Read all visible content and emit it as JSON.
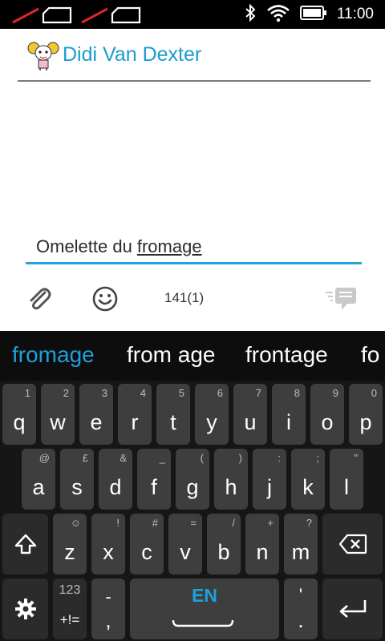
{
  "status_bar": {
    "time": "11:00",
    "icons": [
      "sim-no-signal-icon",
      "sim-no-signal-icon",
      "bluetooth-icon",
      "wifi-icon",
      "battery-icon"
    ]
  },
  "conversation": {
    "contact_name": "Didi Van Dexter",
    "message_text": "Omelette du",
    "message_word": "fromage",
    "char_counter": "141(1)",
    "icons": [
      "paperclip-icon",
      "smiley-icon",
      "send-icon"
    ]
  },
  "keyboard": {
    "suggestions": [
      "fromage",
      "from age",
      "frontage",
      "fo"
    ],
    "row1": [
      {
        "main": "q",
        "hint": "1"
      },
      {
        "main": "w",
        "hint": "2"
      },
      {
        "main": "e",
        "hint": "3"
      },
      {
        "main": "r",
        "hint": "4"
      },
      {
        "main": "t",
        "hint": "5"
      },
      {
        "main": "y",
        "hint": "6"
      },
      {
        "main": "u",
        "hint": "7"
      },
      {
        "main": "i",
        "hint": "8"
      },
      {
        "main": "o",
        "hint": "9"
      },
      {
        "main": "p",
        "hint": "0"
      }
    ],
    "row2": [
      {
        "main": "a",
        "hint": "@"
      },
      {
        "main": "s",
        "hint": "£"
      },
      {
        "main": "d",
        "hint": "&"
      },
      {
        "main": "f",
        "hint": "_"
      },
      {
        "main": "g",
        "hint": "("
      },
      {
        "main": "h",
        "hint": ")"
      },
      {
        "main": "j",
        "hint": ":"
      },
      {
        "main": "k",
        "hint": ";"
      },
      {
        "main": "l",
        "hint": "\""
      }
    ],
    "row3": [
      {
        "main": "z",
        "hint": "☺"
      },
      {
        "main": "x",
        "hint": "!"
      },
      {
        "main": "c",
        "hint": "#"
      },
      {
        "main": "v",
        "hint": "="
      },
      {
        "main": "b",
        "hint": "/"
      },
      {
        "main": "n",
        "hint": "+"
      },
      {
        "main": "m",
        "hint": "?"
      }
    ],
    "symbols_top": "123",
    "symbols_bottom": "+!=",
    "dash_key": "-",
    "comma_key": ",",
    "space_label": "EN",
    "apostrophe_key": "'",
    "period_key": ".",
    "icons": [
      "shift-icon",
      "backspace-icon",
      "settings-icon",
      "enter-icon"
    ],
    "accent_color": "#1da1db"
  }
}
